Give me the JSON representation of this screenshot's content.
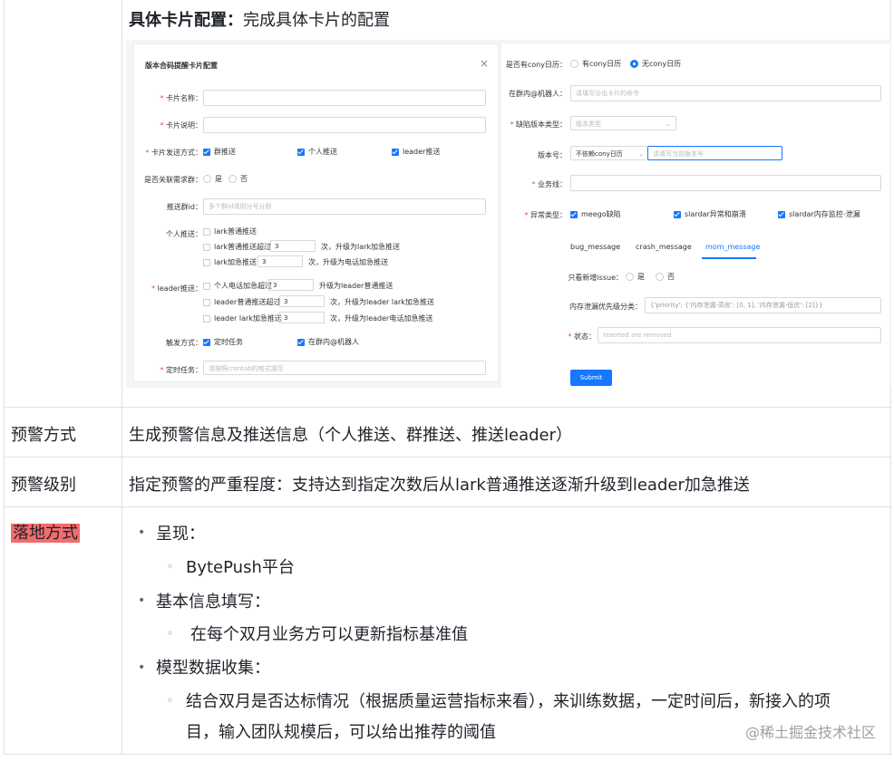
{
  "top": {
    "title_bold": "具体卡片配置：",
    "title_rest": "完成具体卡片的配置"
  },
  "left_form": {
    "title": "版本合码提醒卡片配置",
    "close": "×",
    "card_name_label": "卡片名称：",
    "card_desc_label": "卡片说明：",
    "send_mode_label": "卡片发送方式：",
    "send_group": "群推送",
    "send_personal": "个人推送",
    "send_leader": "leader推送",
    "link_group_label": "是否关联需求群：",
    "yes": "是",
    "no": "否",
    "push_group_label": "推送群id：",
    "push_group_placeholder": "多个群id请用分号分割",
    "personal_label": "个人推送：",
    "p1": "lark普通推送",
    "p2_a": "lark普通推送超过",
    "p2_n": "3",
    "p2_b": "次，升级为lark加急推送",
    "p3_a": "lark加急推送",
    "p3_n": "3",
    "p3_b": "次，升级为电话加急推送",
    "leader_label": "leader推送：",
    "l1_a": "个人电话加急超过",
    "l1_n": "3",
    "l1_b": "升级为leader普通推送",
    "l2_a": "leader普通推送超过",
    "l2_n": "3",
    "l2_b": "次，升级为leader lark加急推送",
    "l3_a": "leader lark加急推送",
    "l3_n": "3",
    "l3_b": "次，升级为leader电话加急推送",
    "trigger_label": "触发方式：",
    "trigger_timer": "定时任务",
    "trigger_bot": "在群内@机器人",
    "timer_label": "定时任务：",
    "timer_placeholder": "请按照crontab的格式填写"
  },
  "right_form": {
    "cony_label": "是否有cony日历：",
    "cony_yes": "有cony日历",
    "cony_no": "无cony日历",
    "bot_label": "在群内@机器人：",
    "bot_placeholder": "请填写@出卡片的命令",
    "bug_type_label": "缺陷版本类型：",
    "bug_type_placeholder": "版本类型",
    "version_label": "版本号：",
    "version_select": "不依赖cony日历",
    "version_placeholder": "请填写当前版本号",
    "biz_label": "业务线：",
    "abnormal_label": "异常类型：",
    "ab1": "meego缺陷",
    "ab2": "slardar异常和崩溃",
    "ab3": "slardar内存监控-泄漏",
    "tabs": [
      "bug_message",
      "crash_message",
      "mom_message"
    ],
    "only_new_label": "只看新增issue：",
    "yes": "是",
    "no": "否",
    "mem_label": "内存泄漏优先级分类：",
    "mem_value": "{'priority': {'内存泄漏-高优': [0, 1], '内存泄漏-低优': [2]}}",
    "status_label": "状态：",
    "status_placeholder": "Inserted are removed",
    "submit": "Submit"
  },
  "rows": {
    "alert_mode_label": "预警方式",
    "alert_mode_text": "生成预警信息及推送信息（个人推送、群推送、推送leader）",
    "alert_level_label": "预警级别",
    "alert_level_text": "指定预警的严重程度：支持达到指定次数后从lark普通推送逐渐升级到leader加急推送",
    "landing_label": "落地方式",
    "b1": "呈现：",
    "b1_1": "BytePush平台",
    "b2": "基本信息填写：",
    "b2_1": "在每个双月业务方可以更新指标基准值",
    "b3": "模型数据收集：",
    "b3_1a": "结合双月是否达标情况（根据质量运营指标来看），来训练数据，一定时间后，新接入的项",
    "b3_1b": "目，输入团队规模后，可以给出推荐的阈值"
  },
  "watermark": "@稀土掘金技术社区",
  "colors": {
    "accent": "#1677ff",
    "highlight": "#f26d6d"
  }
}
